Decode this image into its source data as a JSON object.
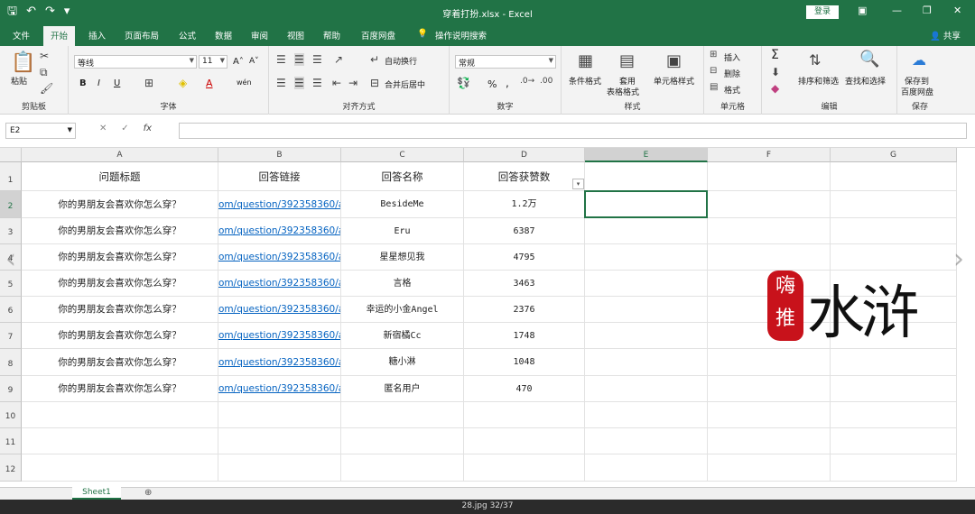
{
  "titlebar": {
    "title": "穿着打扮.xlsx  -  Excel",
    "login": "登录",
    "save_icon": "save-icon",
    "qa_icons": [
      "↶",
      "↷",
      "▾"
    ],
    "window_controls": [
      "▣",
      "—",
      "❐",
      "✕"
    ]
  },
  "menu": {
    "tabs": [
      "文件",
      "开始",
      "插入",
      "页面布局",
      "公式",
      "数据",
      "审阅",
      "视图",
      "帮助",
      "百度网盘",
      "操作说明搜索"
    ],
    "active": "开始",
    "share": "共享"
  },
  "ribbon": {
    "clipboard": {
      "label": "剪贴板",
      "paste": "粘贴"
    },
    "font": {
      "label": "字体",
      "font_name": "等线",
      "font_size": "11",
      "bold": "B",
      "italic": "I",
      "underline": "U",
      "grow": "A˄",
      "shrink": "A˅",
      "color_a": "A",
      "wen": "wén"
    },
    "alignment": {
      "label": "对齐方式",
      "wrap": "自动换行",
      "merge": "合并后居中"
    },
    "number": {
      "label": "数字",
      "format": "常规",
      "percent": "%",
      "comma": ","
    },
    "styles": {
      "label": "样式",
      "cond": "条件格式",
      "table": "套用",
      "table2": "表格格式",
      "cellstyle": "单元格样式"
    },
    "cells": {
      "label": "单元格",
      "insert": "插入",
      "delete": "删除",
      "format": "格式"
    },
    "editing": {
      "label": "编辑",
      "sum": "Σ",
      "sort": "排序和筛选",
      "find": "查找和选择"
    },
    "save": {
      "label": "保存",
      "save1": "保存到",
      "save2": "百度网盘"
    }
  },
  "formula_bar": {
    "name_box": "E2",
    "fx": "fx",
    "value": ""
  },
  "columns": [
    "A",
    "B",
    "C",
    "D",
    "E",
    "F",
    "G"
  ],
  "selected_col": "E",
  "selected_row": "2",
  "rows": [
    "1",
    "2",
    "3",
    "4",
    "5",
    "6",
    "7",
    "8",
    "9",
    "10",
    "11",
    "12"
  ],
  "headers": {
    "A": "问题标题",
    "B": "回答链接",
    "C": "回答名称",
    "D": "回答获赞数"
  },
  "table": [
    {
      "q": "你的男朋友会喜欢你怎么穿？",
      "link": "om/question/392358360/a",
      "name": "BesideMe",
      "likes": "1.2万"
    },
    {
      "q": "你的男朋友会喜欢你怎么穿？",
      "link": "om/question/392358360/a",
      "name": "Eru",
      "likes": "6387"
    },
    {
      "q": "你的男朋友会喜欢你怎么穿？",
      "link": "om/question/392358360/a",
      "name": "星星想见我",
      "likes": "4795"
    },
    {
      "q": "你的男朋友会喜欢你怎么穿？",
      "link": "om/question/392358360/a",
      "name": "言格",
      "likes": "3463"
    },
    {
      "q": "你的男朋友会喜欢你怎么穿？",
      "link": "om/question/392358360/a",
      "name": "幸运的小金Angel",
      "likes": "2376"
    },
    {
      "q": "你的男朋友会喜欢你怎么穿？",
      "link": "om/question/392358360/a",
      "name": "新宿橘Cc",
      "likes": "1748"
    },
    {
      "q": "你的男朋友会喜欢你怎么穿？",
      "link": "om/question/392358360/a",
      "name": "糖小淋",
      "likes": "1048"
    },
    {
      "q": "你的男朋友会喜欢你怎么穿？",
      "link": "om/question/392358360/a",
      "name": "匿名用户",
      "likes": "470"
    }
  ],
  "watermark": {
    "seal_line1": "嗨",
    "seal_line2": "推",
    "text": "水浒"
  },
  "sheet": {
    "name": "Sheet1",
    "add": "⊕"
  },
  "viewer": {
    "caption": "28.jpg   32/37"
  },
  "colors": {
    "accent": "#217346",
    "link": "#0563c1",
    "seal": "#c8121b"
  }
}
